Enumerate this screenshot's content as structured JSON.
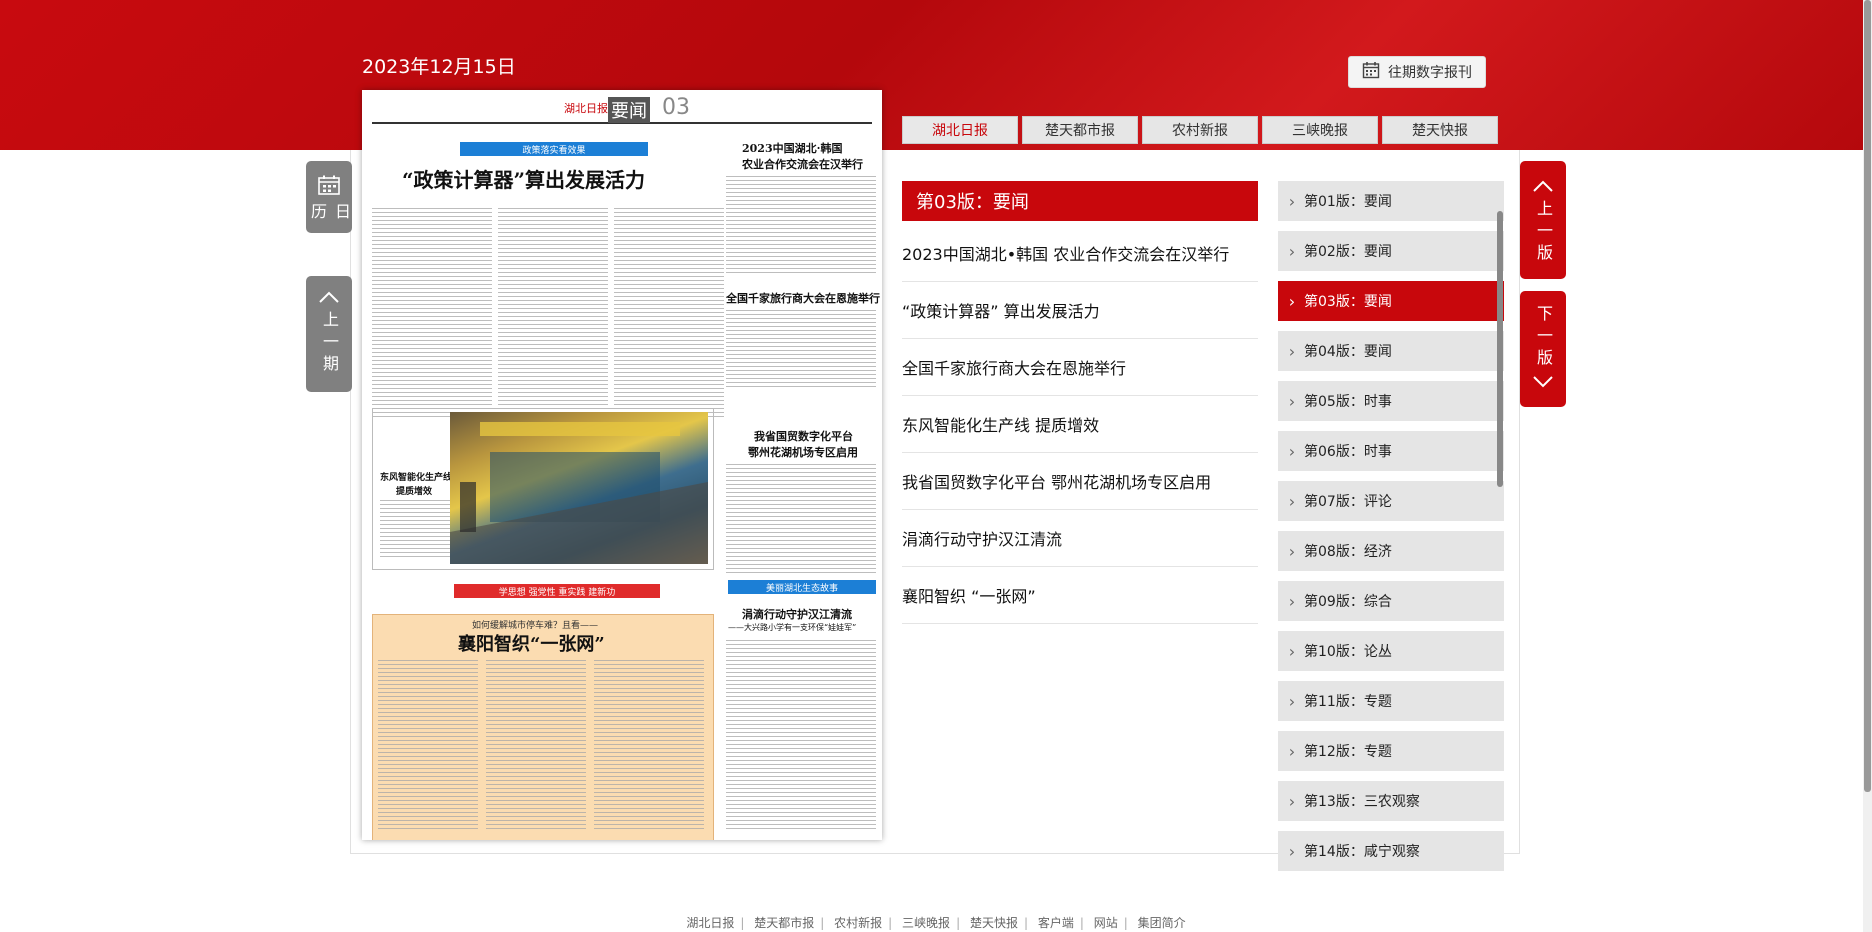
{
  "header": {
    "date": "2023年12月15日",
    "archive_label": "往期数字报刊"
  },
  "side_nav": {
    "calendar_label": "日历",
    "prev_issue_label": "上一期",
    "prev_page_label": "上一版",
    "next_page_label": "下一版"
  },
  "newspaper_page": {
    "logo": "湖北日报",
    "section": "要闻",
    "number": "03",
    "banner_top": "政策落实看效果",
    "headline_main": "“政策计算器”算出发展活力",
    "headline_right_1": "2023中国湖北·韩国",
    "headline_right_2": "农业合作交流会在汉举行",
    "headline_tour": "全国千家旅行商大会在恩施举行",
    "headline_trade_1": "我省国贸数字化平台",
    "headline_trade_2": "鄂州花湖机场专区启用",
    "headline_dongfeng_1": "东风智能化生产线",
    "headline_dongfeng_2": "提质增效",
    "banner_mid": "学思想 强党性 重实践 建新功",
    "banner_eco": "美丽湖北生态故事",
    "headline_river": "涓滴行动守护汉江清流",
    "subhead_river": "——大兴路小学有一支环保“娃娃军”",
    "question": "如何缓解城市停车难？且看——",
    "headline_xiangyang": "襄阳智织“一张网”"
  },
  "publication_tabs": [
    {
      "label": "湖北日报",
      "active": true
    },
    {
      "label": "楚天都市报",
      "active": false
    },
    {
      "label": "农村新报",
      "active": false
    },
    {
      "label": "三峡晚报",
      "active": false
    },
    {
      "label": "楚天快报",
      "active": false
    }
  ],
  "current_section": "第03版：要闻",
  "articles": [
    "2023中国湖北•韩国 农业合作交流会在汉举行",
    "“政策计算器” 算出发展活力",
    "全国千家旅行商大会在恩施举行",
    "东风智能化生产线 提质增效",
    "我省国贸数字化平台 鄂州花湖机场专区启用",
    "涓滴行动守护汉江清流",
    "襄阳智织 “一张网”"
  ],
  "editions": [
    {
      "label": "第01版：要闻",
      "active": false
    },
    {
      "label": "第02版：要闻",
      "active": false
    },
    {
      "label": "第03版：要闻",
      "active": true
    },
    {
      "label": "第04版：要闻",
      "active": false
    },
    {
      "label": "第05版：时事",
      "active": false
    },
    {
      "label": "第06版：时事",
      "active": false
    },
    {
      "label": "第07版：评论",
      "active": false
    },
    {
      "label": "第08版：经济",
      "active": false
    },
    {
      "label": "第09版：综合",
      "active": false
    },
    {
      "label": "第10版：论丛",
      "active": false
    },
    {
      "label": "第11版：专题",
      "active": false
    },
    {
      "label": "第12版：专题",
      "active": false
    },
    {
      "label": "第13版：三农观察",
      "active": false
    },
    {
      "label": "第14版：咸宁观察",
      "active": false
    }
  ],
  "footer_links": [
    "湖北日报",
    "楚天都市报",
    "农村新报",
    "三峡晚报",
    "楚天快报",
    "客户端",
    "网站",
    "集团简介"
  ],
  "colors": {
    "brand_red": "#c8070c",
    "side_gray": "#808080"
  }
}
